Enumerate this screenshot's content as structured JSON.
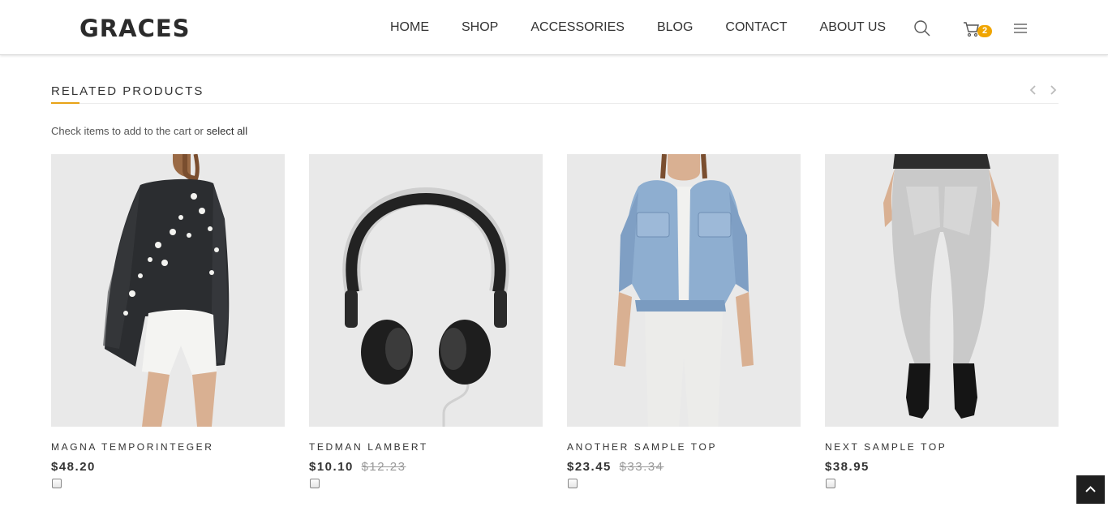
{
  "header": {
    "logo": "GRACES",
    "nav": [
      "HOME",
      "SHOP",
      "ACCESSORIES",
      "BLOG",
      "CONTACT",
      "ABOUT US"
    ],
    "cart_count": "2",
    "icons": [
      "search-icon",
      "cart-icon",
      "menu-icon"
    ]
  },
  "related": {
    "title": "RELATED PRODUCTS",
    "hint_prefix": "Check items to add to the cart or",
    "select_all": "select all"
  },
  "products": [
    {
      "name": "MAGNA TEMPORINTEGER",
      "price": "$48.20",
      "old_price": ""
    },
    {
      "name": "TEDMAN LAMBERT",
      "price": "$10.10",
      "old_price": "$12.23"
    },
    {
      "name": "ANOTHER SAMPLE TOP",
      "price": "$23.45",
      "old_price": "$33.34"
    },
    {
      "name": "NEXT SAMPLE TOP",
      "price": "$38.95",
      "old_price": ""
    }
  ],
  "colors": {
    "accent": "#e8a317",
    "badge": "#f0a500",
    "back_to_top_bg": "#1f1f1f",
    "image_bg": "#e9e9e9"
  }
}
